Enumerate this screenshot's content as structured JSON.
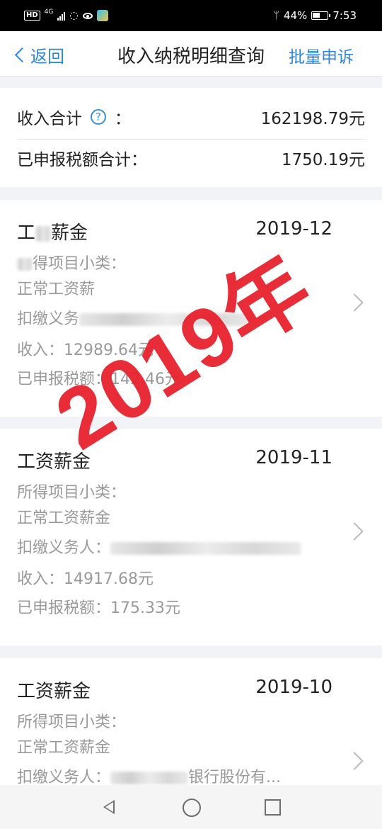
{
  "status_bar": {
    "hd": "HD",
    "network": "4G",
    "battery": "44%",
    "time": "7:53",
    "icons": [
      "hd-icon",
      "signal-icon",
      "wifi-icon",
      "eye-icon",
      "app-icon",
      "bluetooth-icon",
      "battery-icon"
    ]
  },
  "nav": {
    "back_label": "返回",
    "title": "收入纳税明细查询",
    "action_label": "批量申诉"
  },
  "summary": {
    "income_label": "收入合计",
    "colon": "：",
    "income_value": "162198.79元",
    "tax_label": "已申报税额合计：",
    "tax_value": "1750.19元"
  },
  "records": [
    {
      "type": "工资薪金",
      "type_visible": "工",
      "type_visible_end": "薪金",
      "date": "2019-12",
      "sub_label": "所得项目小类：",
      "sub_label_visible": "得项目小类：",
      "sub_value": "正常工资薪",
      "withholder_label": "扣缴义务",
      "income_label": "收入：",
      "income_value": "12989.64元",
      "tax_label": "已申报税额：",
      "tax_value": "142.46元"
    },
    {
      "type": "工资薪金",
      "date": "2019-11",
      "sub_label": "所得项目小类：",
      "sub_value": "正常工资薪金",
      "withholder_label": "扣缴义务人：",
      "income_label": "收入：",
      "income_value": "14917.68元",
      "tax_label": "已申报税额：",
      "tax_value": "175.33元"
    },
    {
      "type": "工资薪金",
      "date": "2019-10",
      "sub_label": "所得项目小类：",
      "sub_value": "正常工资薪金",
      "withholder_label": "扣缴义务人：",
      "withholder_value": "银行股份有..."
    }
  ],
  "watermark": "2019年",
  "colors": {
    "accent": "#2f86e0",
    "watermark": "#e8222e",
    "muted_text": "#999999"
  }
}
